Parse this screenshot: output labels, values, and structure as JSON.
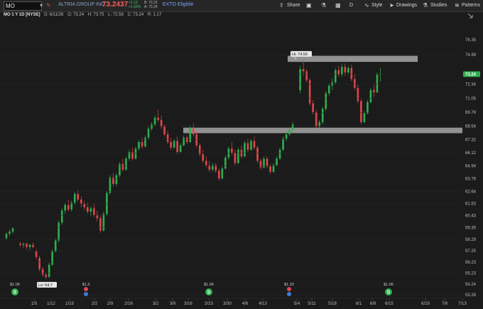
{
  "toolbar": {
    "symbol": "MO",
    "company": "ALTRIA GROUP INC",
    "last_price": "73.2437",
    "change_abs": "+1.13",
    "change_pct": "+1.56%",
    "bid": "B: 73.22",
    "ask": "A: 73.24",
    "exto": "EXTO Eligible",
    "share": "Share",
    "interval": "D",
    "style": "Style",
    "drawings": "Drawings",
    "studies": "Studies",
    "patterns": "Patterns"
  },
  "info": {
    "label": "MO 1 Y 1D [NYSE]",
    "date": "D: 6/11/26",
    "open": "O: 73.24",
    "high": "H: 73.75",
    "low": "L: 72.58",
    "close": "C: 73.24",
    "range": "R: 1.17"
  },
  "colors": {
    "up": "#2fae4e",
    "down": "#e0474c",
    "zone": "#a6a6a6",
    "price_tag": "#2fae4e"
  },
  "chart_data": {
    "type": "candlestick",
    "y_ticks": [
      "76.35",
      "74.99",
      "73.24",
      "72.34",
      "71.05",
      "69.78",
      "68.54",
      "67.32",
      "66.12",
      "64.94",
      "63.78",
      "62.64",
      "61.53",
      "60.43",
      "59.35",
      "58.29",
      "57.25",
      "56.23",
      "55.23",
      "54.24",
      "53.28"
    ],
    "x_ticks": [
      "1/5",
      "1/12",
      "1/19",
      "2/2",
      "2/9",
      "2/16",
      "3/2",
      "3/9",
      "3/16",
      "3/23",
      "3/30",
      "4/6",
      "4/13",
      "5/4",
      "5/11",
      "5/18",
      "6/1",
      "6/8",
      "6/15",
      "6/29",
      "7/6",
      "7/13"
    ],
    "current_price_label": "73.24",
    "hi_label": "Hi: 74.56",
    "lo_label": "Lo: 54.7",
    "zones": [
      {
        "top": 74.9,
        "bottom": 74.35
      },
      {
        "top": 68.4,
        "bottom": 67.9
      }
    ],
    "dividends": [
      {
        "label": "$1.06",
        "date": "12/24"
      },
      {
        "label": "$1.3",
        "date": "1/28",
        "earnings": true
      },
      {
        "label": "$1.06",
        "date": "3/24"
      },
      {
        "label": "$1.32",
        "date": "4/30",
        "earnings": true
      },
      {
        "label": "$1.06",
        "date": "6/9"
      }
    ],
    "candles": [
      [
        58.4,
        58.9,
        58.2,
        58.8
      ],
      [
        58.8,
        59.2,
        58.6,
        59.0
      ],
      [
        59.0,
        59.4,
        58.8,
        59.3
      ],
      [
        57.9,
        58.1,
        57.6,
        57.8
      ],
      [
        57.8,
        58.0,
        57.5,
        57.9
      ],
      [
        57.9,
        58.0,
        57.4,
        57.6
      ],
      [
        57.6,
        57.9,
        57.3,
        57.8
      ],
      [
        57.8,
        58.0,
        57.5,
        57.6
      ],
      [
        57.2,
        57.4,
        56.5,
        56.7
      ],
      [
        56.6,
        56.8,
        55.4,
        55.6
      ],
      [
        55.6,
        55.8,
        54.9,
        55.1
      ],
      [
        55.1,
        55.3,
        54.7,
        54.9
      ],
      [
        54.9,
        56.2,
        54.8,
        56.0
      ],
      [
        56.0,
        57.4,
        55.9,
        57.2
      ],
      [
        57.2,
        58.4,
        57.1,
        58.2
      ],
      [
        58.2,
        60.0,
        58.0,
        59.8
      ],
      [
        59.8,
        61.1,
        59.6,
        60.9
      ],
      [
        60.9,
        61.6,
        60.6,
        61.4
      ],
      [
        61.4,
        61.9,
        60.8,
        61.0
      ],
      [
        61.0,
        61.8,
        60.8,
        61.6
      ],
      [
        61.6,
        62.6,
        61.4,
        62.4
      ],
      [
        62.4,
        62.8,
        61.7,
        61.9
      ],
      [
        61.9,
        62.2,
        61.2,
        61.5
      ],
      [
        61.5,
        61.8,
        60.9,
        61.2
      ],
      [
        61.2,
        61.6,
        60.6,
        60.8
      ],
      [
        60.8,
        61.3,
        60.4,
        61.1
      ],
      [
        61.1,
        61.5,
        60.3,
        60.5
      ],
      [
        60.5,
        60.9,
        59.9,
        60.2
      ],
      [
        60.2,
        60.5,
        58.9,
        59.1
      ],
      [
        59.1,
        60.8,
        59.0,
        60.6
      ],
      [
        60.6,
        62.7,
        60.4,
        62.5
      ],
      [
        62.5,
        64.1,
        62.3,
        63.9
      ],
      [
        63.9,
        64.3,
        63.1,
        63.3
      ],
      [
        63.3,
        64.3,
        63.1,
        64.1
      ],
      [
        64.1,
        65.3,
        63.9,
        65.1
      ],
      [
        65.1,
        65.6,
        64.4,
        64.6
      ],
      [
        64.6,
        65.8,
        64.5,
        65.6
      ],
      [
        65.6,
        66.4,
        65.4,
        66.2
      ],
      [
        66.2,
        66.6,
        65.4,
        65.6
      ],
      [
        65.6,
        66.7,
        65.5,
        66.5
      ],
      [
        66.5,
        67.3,
        66.3,
        67.1
      ],
      [
        67.1,
        67.5,
        66.5,
        66.7
      ],
      [
        66.7,
        67.7,
        66.6,
        67.5
      ],
      [
        67.5,
        68.5,
        67.3,
        68.3
      ],
      [
        68.3,
        68.9,
        68.1,
        68.7
      ],
      [
        68.7,
        69.5,
        68.5,
        69.3
      ],
      [
        69.3,
        70.0,
        68.9,
        69.1
      ],
      [
        69.1,
        69.5,
        68.3,
        68.5
      ],
      [
        68.5,
        68.7,
        67.6,
        67.8
      ],
      [
        67.8,
        68.1,
        66.9,
        67.1
      ],
      [
        67.1,
        67.5,
        66.4,
        66.6
      ],
      [
        66.6,
        67.4,
        66.5,
        67.2
      ],
      [
        67.2,
        67.6,
        66.0,
        66.2
      ],
      [
        66.2,
        67.0,
        66.1,
        66.8
      ],
      [
        66.8,
        67.7,
        66.7,
        67.5
      ],
      [
        67.5,
        67.7,
        66.9,
        67.1
      ],
      [
        67.1,
        68.6,
        67.0,
        68.4
      ],
      [
        68.4,
        68.8,
        67.6,
        67.8
      ],
      [
        67.8,
        68.1,
        66.6,
        66.8
      ],
      [
        66.8,
        67.0,
        65.8,
        66.0
      ],
      [
        66.0,
        66.4,
        65.2,
        65.4
      ],
      [
        65.4,
        65.8,
        64.8,
        65.0
      ],
      [
        65.0,
        65.4,
        64.4,
        64.6
      ],
      [
        64.6,
        65.2,
        64.4,
        65.0
      ],
      [
        65.0,
        65.2,
        64.3,
        64.5
      ],
      [
        64.5,
        64.7,
        63.6,
        63.8
      ],
      [
        63.8,
        64.9,
        63.7,
        64.7
      ],
      [
        64.7,
        65.9,
        64.6,
        65.7
      ],
      [
        65.7,
        66.7,
        65.5,
        66.5
      ],
      [
        66.5,
        67.1,
        65.9,
        66.1
      ],
      [
        66.1,
        66.4,
        65.0,
        65.2
      ],
      [
        65.2,
        66.6,
        65.1,
        66.4
      ],
      [
        66.4,
        66.8,
        65.6,
        65.8
      ],
      [
        65.8,
        67.2,
        65.7,
        67.0
      ],
      [
        67.0,
        67.4,
        66.2,
        66.4
      ],
      [
        66.4,
        67.4,
        66.3,
        67.2
      ],
      [
        67.2,
        67.6,
        66.4,
        66.6
      ],
      [
        66.6,
        66.8,
        65.2,
        65.4
      ],
      [
        65.4,
        65.6,
        64.6,
        64.8
      ],
      [
        64.8,
        65.8,
        64.7,
        65.6
      ],
      [
        65.6,
        65.8,
        64.7,
        64.9
      ],
      [
        64.9,
        65.1,
        64.2,
        64.4
      ],
      [
        64.4,
        65.2,
        64.3,
        65.0
      ],
      [
        65.0,
        65.8,
        64.9,
        65.6
      ],
      [
        65.6,
        66.6,
        65.5,
        66.4
      ],
      [
        66.4,
        67.6,
        66.3,
        67.4
      ],
      [
        67.4,
        68.0,
        67.2,
        67.8
      ],
      [
        67.8,
        68.4,
        67.6,
        68.2
      ],
      [
        68.2,
        68.9,
        68.0,
        68.7
      ],
      [
        71.8,
        74.0,
        71.5,
        73.7
      ],
      [
        73.7,
        74.56,
        73.1,
        73.5
      ],
      [
        73.5,
        73.7,
        72.5,
        72.7
      ],
      [
        72.7,
        72.9,
        70.4,
        70.6
      ],
      [
        70.6,
        70.9,
        69.6,
        69.8
      ],
      [
        69.8,
        70.0,
        68.3,
        68.5
      ],
      [
        68.5,
        69.1,
        68.3,
        68.9
      ],
      [
        68.9,
        70.3,
        68.7,
        70.1
      ],
      [
        70.1,
        71.7,
        69.9,
        71.5
      ],
      [
        71.5,
        72.4,
        71.3,
        72.2
      ],
      [
        72.2,
        72.9,
        71.8,
        72.5
      ],
      [
        72.5,
        73.8,
        72.3,
        73.6
      ],
      [
        73.6,
        74.0,
        73.0,
        73.2
      ],
      [
        73.2,
        74.2,
        73.0,
        73.9
      ],
      [
        73.9,
        74.2,
        73.1,
        73.4
      ],
      [
        73.4,
        74.0,
        73.2,
        73.8
      ],
      [
        73.8,
        74.1,
        72.6,
        72.8
      ],
      [
        72.8,
        73.2,
        71.8,
        72.0
      ],
      [
        72.0,
        72.3,
        70.6,
        70.8
      ],
      [
        70.8,
        71.0,
        68.7,
        68.9
      ],
      [
        68.9,
        69.9,
        68.8,
        69.7
      ],
      [
        69.7,
        70.9,
        69.6,
        70.7
      ],
      [
        70.7,
        72.0,
        70.6,
        71.8
      ],
      [
        71.8,
        72.4,
        71.2,
        71.6
      ],
      [
        71.6,
        73.4,
        71.5,
        73.2
      ],
      [
        73.2,
        73.8,
        72.58,
        73.24
      ]
    ]
  }
}
